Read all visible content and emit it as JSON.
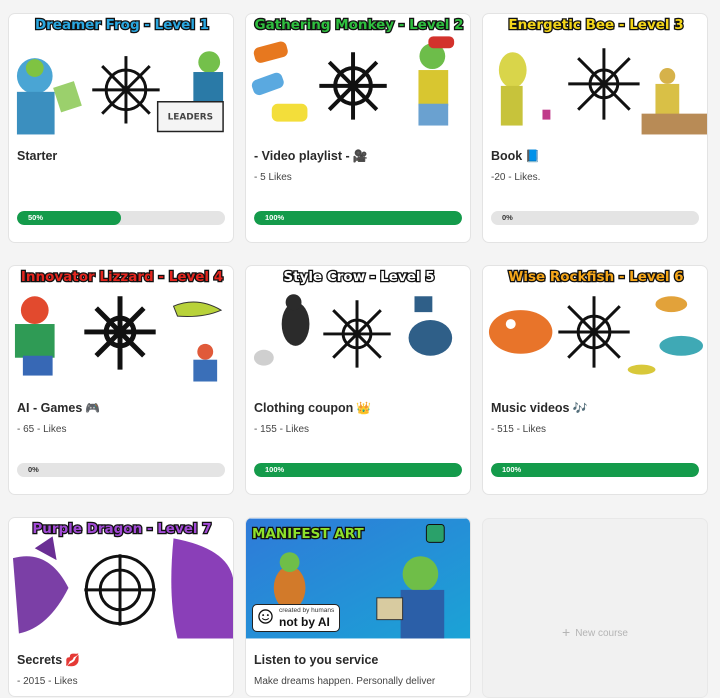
{
  "cards": [
    {
      "thumb_title": "Dreamer Frog - Level 1",
      "title": "Starter",
      "emoji": "",
      "likes": "",
      "progress_label": "50%",
      "progress": 0.5
    },
    {
      "thumb_title": "Gathering Monkey - Level 2",
      "title": "- Video playlist -",
      "emoji": "🎥",
      "likes": "- 5 Likes",
      "progress_label": "100%",
      "progress": 1.0
    },
    {
      "thumb_title": "Energetic Bee - Level 3",
      "title": "Book",
      "emoji": "📘",
      "likes": "-20 - Likes.",
      "progress_label": "0%",
      "progress": 0.0
    },
    {
      "thumb_title": "Innovator Lizzard - Level 4",
      "title": "AI - Games",
      "emoji": "🎮",
      "likes": "- 65 - Likes",
      "progress_label": "0%",
      "progress": 0.0
    },
    {
      "thumb_title": "Style Crow - Level 5",
      "title": "Clothing coupon",
      "emoji": "👑",
      "likes": "- 155 - Likes",
      "progress_label": "100%",
      "progress": 1.0
    },
    {
      "thumb_title": "Wise Rockfish - Level 6",
      "title": "Music videos",
      "emoji": "🎶",
      "likes": "- 515 - Likes",
      "progress_label": "100%",
      "progress": 1.0
    },
    {
      "thumb_title": "Purple Dragon - Level 7",
      "title": "Secrets",
      "emoji": "💋",
      "likes": "- 2015 - Likes"
    },
    {
      "thumb_title": "MANIFEST ART",
      "badge_line1": "created by humans",
      "badge_line2": "not by AI",
      "title": "Listen to you service",
      "description": "Make dreams happen. Personally deliver"
    }
  ],
  "new_course": {
    "label": "New course",
    "icon": "plus-icon"
  },
  "colors": {
    "progress_fill": "#149b4b",
    "progress_track": "#e4e4e4",
    "level1": "#2aa7e0",
    "level2": "#2fbf3f",
    "level3": "#f3d51a",
    "level4": "#e3261f",
    "level5": "#ffffff",
    "level6": "#f6a71a",
    "level7": "#a24ad6",
    "manifest": "#8ee12b"
  }
}
